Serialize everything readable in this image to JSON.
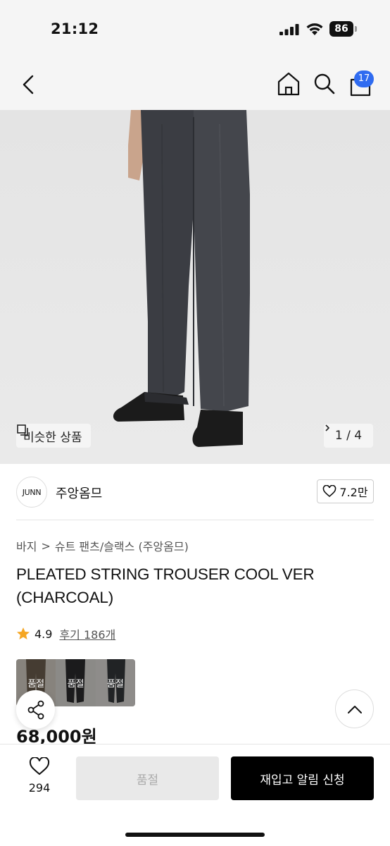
{
  "status_bar": {
    "time": "21:12",
    "battery": "86"
  },
  "nav": {
    "cart_count": "17"
  },
  "hero": {
    "similar_label": "비슷한 상품",
    "pager": "1 / 4"
  },
  "brand": {
    "logo_text": "JUNN",
    "name": "주앙옴므",
    "likes": "7.2만"
  },
  "breadcrumb": {
    "category": "바지",
    "separator": ">",
    "subcategory": "슈트 팬츠/슬랙스 (주앙옴므)"
  },
  "product": {
    "title": "PLEATED STRING TROUSER COOL VER (CHARCOAL)",
    "rating": "4.9",
    "reviews": "후기 186개",
    "price": "68,000원"
  },
  "thumbnails": [
    {
      "label": "품절"
    },
    {
      "label": "품절"
    },
    {
      "label": "품절"
    }
  ],
  "bottom_bar": {
    "wish_count": "294",
    "soldout_label": "품절",
    "restock_label": "재입고 알림 신청"
  },
  "colors": {
    "accent_blue": "#2f6bf0",
    "star": "#f5a623",
    "primary_button": "#000000"
  }
}
